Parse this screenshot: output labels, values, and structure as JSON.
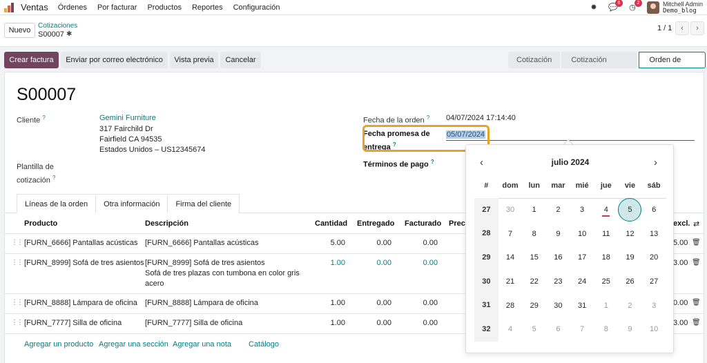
{
  "navbar": {
    "app_name": "Ventas",
    "menu": [
      "Órdenes",
      "Por facturar",
      "Productos",
      "Reportes",
      "Configuración"
    ],
    "messages_badge": "6",
    "activities_badge": "2",
    "user_name": "Mitchell Admin",
    "database": "Demo_blog",
    "logo_colors": [
      "#f0a73b",
      "#e0613c",
      "#71455e"
    ]
  },
  "control_panel": {
    "new_button": "Nuevo",
    "breadcrumb": "Cotizaciones",
    "record_name": "S00007",
    "pager": "1 / 1",
    "prev": "‹",
    "next": "›"
  },
  "actions": {
    "create_invoice": "Crear factura",
    "send_email": "Enviar por correo electrónico",
    "preview": "Vista previa",
    "cancel": "Cancelar"
  },
  "status_stages": {
    "draft": "Cotización",
    "sent": "Cotización enviada",
    "sale": "Orden de venta",
    "active": "Orden de venta"
  },
  "form": {
    "title": "S00007",
    "customer_label": "Cliente",
    "customer_name": "Gemini Furniture",
    "address_1": "317 Fairchild Dr",
    "address_2": "Fairfield CA 94535",
    "address_3": "Estados Unidos – US12345674",
    "template_label_1": "Plantilla de",
    "template_label_2": "cotización",
    "order_date_label": "Fecha de la orden",
    "order_date": "04/07/2024 17:14:40",
    "promise_label_1": "Fecha promesa de",
    "promise_label_2": "entrega",
    "promise_date": "05/07/2024",
    "payment_terms_label": "Términos de pago",
    "help": "?"
  },
  "tabs": [
    "Líneas de la orden",
    "Otra información",
    "Firma del cliente"
  ],
  "table": {
    "headers": {
      "product": "Producto",
      "description": "Descripción",
      "quantity": "Cantidad",
      "delivered": "Entregado",
      "invoiced": "Facturado",
      "price": "Preci",
      "excl": "excl."
    },
    "rows": [
      {
        "product": "[FURN_6666] Pantallas acústicas",
        "description": "[FURN_6666] Pantallas acústicas",
        "description_2": "",
        "description_3": "",
        "quantity": "5.00",
        "delivered": "0.00",
        "invoiced": "0.00",
        "subtotal": "5.00"
      },
      {
        "product": "[FURN_8999] Sofá de tres asientos",
        "description": "[FURN_8999] Sofá de tres asientos",
        "description_2": "Sofá de tres plazas con tumbona en color gris",
        "description_3": "acero",
        "quantity": "1.00",
        "delivered": "0.00",
        "invoiced": "0.00",
        "subtotal": "3.00"
      },
      {
        "product": "[FURN_8888] Lámpara de oficina",
        "description": "[FURN_8888] Lámpara de oficina",
        "description_2": "",
        "description_3": "",
        "quantity": "1.00",
        "delivered": "0.00",
        "invoiced": "0.00",
        "subtotal": "0.00"
      },
      {
        "product": "[FURN_7777] Silla de oficina",
        "description": "[FURN_7777] Silla de oficina",
        "description_2": "",
        "description_3": "",
        "quantity": "1.00",
        "delivered": "0.00",
        "invoiced": "0.00",
        "subtotal": "3.00"
      }
    ],
    "add_product": "Agregar un producto",
    "add_section": "Agregar una sección",
    "add_note": "Agregar una nota",
    "catalog": "Catálogo"
  },
  "datepicker": {
    "month_label": "julio 2024",
    "prev": "‹",
    "next": "›",
    "week_header": "#",
    "weekdays": [
      "dom",
      "lun",
      "mar",
      "mié",
      "jue",
      "vie",
      "sáb"
    ],
    "weeks": [
      {
        "num": "27",
        "days": [
          "30",
          "1",
          "2",
          "3",
          "4",
          "5",
          "6"
        ]
      },
      {
        "num": "28",
        "days": [
          "7",
          "8",
          "9",
          "10",
          "11",
          "12",
          "13"
        ]
      },
      {
        "num": "29",
        "days": [
          "14",
          "15",
          "16",
          "17",
          "18",
          "19",
          "20"
        ]
      },
      {
        "num": "30",
        "days": [
          "21",
          "22",
          "23",
          "24",
          "25",
          "26",
          "27"
        ]
      },
      {
        "num": "31",
        "days": [
          "28",
          "29",
          "30",
          "31",
          "1",
          "2",
          "3"
        ]
      },
      {
        "num": "32",
        "days": [
          "4",
          "5",
          "6",
          "7",
          "8",
          "9",
          "10"
        ]
      }
    ],
    "today": "4",
    "selected": "5"
  }
}
